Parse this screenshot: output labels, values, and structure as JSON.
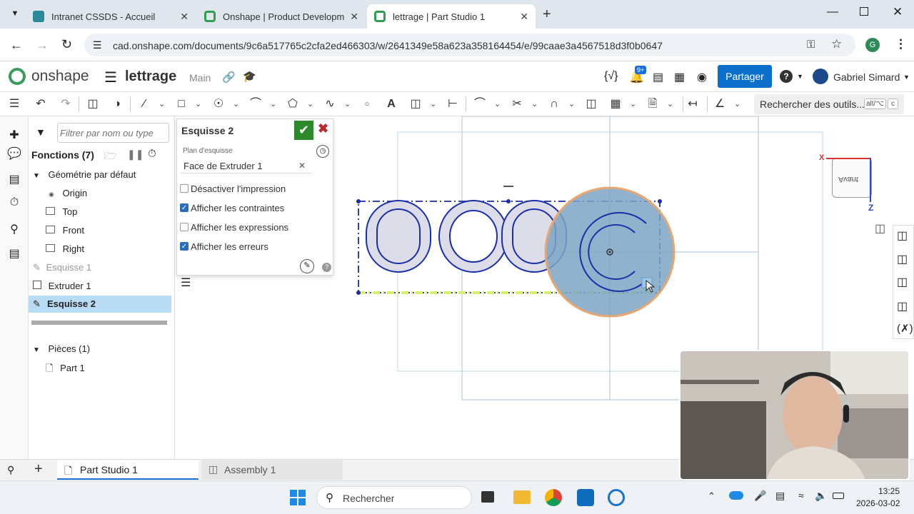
{
  "browser": {
    "tabs": [
      {
        "label": "Intranet CSSDS - Accueil"
      },
      {
        "label": "Onshape | Product Developme"
      },
      {
        "label": "lettrage | Part Studio 1"
      }
    ],
    "url": "cad.onshape.com/documents/9c6a517765c2cfa2ed466303/w/2641349e58a623a358164454/e/99caae3a4567518d3f0b0647",
    "profile_initial": "G"
  },
  "header": {
    "logo": "onshape",
    "doc_title": "lettrage",
    "branch": "Main",
    "notif_badge": "9+",
    "share_label": "Partager",
    "user_name": "Gabriel Simard",
    "brand_color": "#0d6fcc"
  },
  "toolbar": {
    "search_label": "Rechercher des outils...",
    "shortcut": "alt/⌥",
    "shortcut_key": "c"
  },
  "tree": {
    "filter_placeholder": "Filtrer par nom ou type",
    "features_label": "Fonctions (7)",
    "default_geometry": "Géométrie par défaut",
    "planes": [
      "Origin",
      "Top",
      "Front",
      "Right"
    ],
    "features": [
      "Esquisse 1",
      "Extruder 1",
      "Esquisse 2"
    ],
    "parts_label": "Pièces (1)",
    "parts": [
      "Part 1"
    ]
  },
  "sketch_panel": {
    "title": "Esquisse 2",
    "plane_label": "Plan d'esquisse",
    "plane_value": "Face de Extruder 1",
    "options": [
      {
        "label": "Désactiver l'impression",
        "checked": false
      },
      {
        "label": "Afficher les contraintes",
        "checked": true
      },
      {
        "label": "Afficher les expressions",
        "checked": false
      },
      {
        "label": "Afficher les erreurs",
        "checked": true
      }
    ]
  },
  "viewcube": {
    "face_label": "Avant",
    "axis_x": "X",
    "axis_z": "Z"
  },
  "bottom_tabs": [
    {
      "label": "Part Studio 1",
      "active": true
    },
    {
      "label": "Assembly 1",
      "active": false
    }
  ],
  "taskbar": {
    "search_label": "Rechercher",
    "time": "13:25",
    "date": "2026-03-02"
  }
}
